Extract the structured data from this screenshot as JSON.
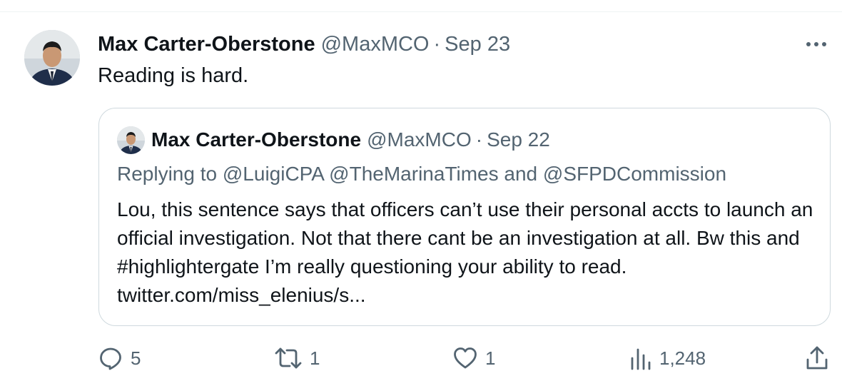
{
  "tweet": {
    "author_name": "Max Carter-Oberstone",
    "author_handle": "@MaxMCO",
    "separator": "·",
    "date": "Sep 23",
    "text": "Reading is hard.",
    "more_icon": "more-horizontal-icon"
  },
  "quoted_tweet": {
    "author_name": "Max Carter-Oberstone",
    "author_handle": "@MaxMCO",
    "separator": "·",
    "date": "Sep 22",
    "replying_label": "Replying to",
    "replying_mentions": "@LuigiCPA @TheMarinaTimes and @SFPDCommission",
    "body": "Lou, this sentence says that officers can’t use their personal accts to launch an official investigation. Not that there cant be an investigation at all. Bw this and #highlightergate I’m really questioning your ability to read. twitter.com/miss_elenius/s..."
  },
  "actions": {
    "reply": {
      "icon": "reply-icon",
      "count": "5"
    },
    "retweet": {
      "icon": "retweet-icon",
      "count": "1"
    },
    "like": {
      "icon": "heart-icon",
      "count": "1"
    },
    "views": {
      "icon": "views-icon",
      "count": "1,248"
    },
    "share": {
      "icon": "share-icon"
    }
  },
  "colors": {
    "text_primary": "#0f1419",
    "text_secondary": "#536471",
    "border": "#cfd9de"
  }
}
